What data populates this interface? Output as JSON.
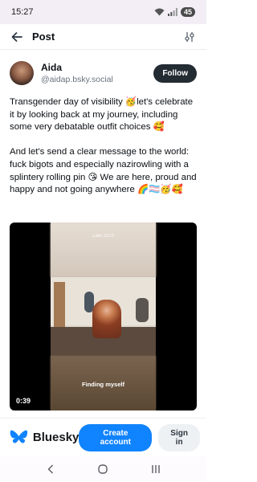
{
  "status_bar": {
    "time": "15:27",
    "battery": "45"
  },
  "header": {
    "title": "Post"
  },
  "post": {
    "display_name": "Aida",
    "handle": "@aidap.bsky.social",
    "follow_label": "Follow",
    "text": "Transgender day of visibility 🥳let's celebrate it by looking back at my journey, including some very debatable outfit choices 🥰\n\nAnd let's send a clear message to the world: fuck bigots and especially nazirowling with a splintery rolling pin 😘 We are here, proud and happy and not going anywhere 🌈🏳️‍⚧️🥳🥰",
    "video": {
      "caption_top": "Late 2023",
      "caption_bottom": "Finding myself",
      "duration": "0:39"
    }
  },
  "footer": {
    "brand": "Bluesky",
    "create_account_label": "Create account",
    "sign_in_label": "Sign in",
    "brand_color": "#1083fe"
  },
  "icons": {
    "back": "arrow-left-icon",
    "filter": "sliders-icon",
    "logo": "butterfly-icon",
    "nav_back": "chevron-left-icon",
    "nav_home": "circle-icon",
    "nav_recents": "bars-icon"
  }
}
